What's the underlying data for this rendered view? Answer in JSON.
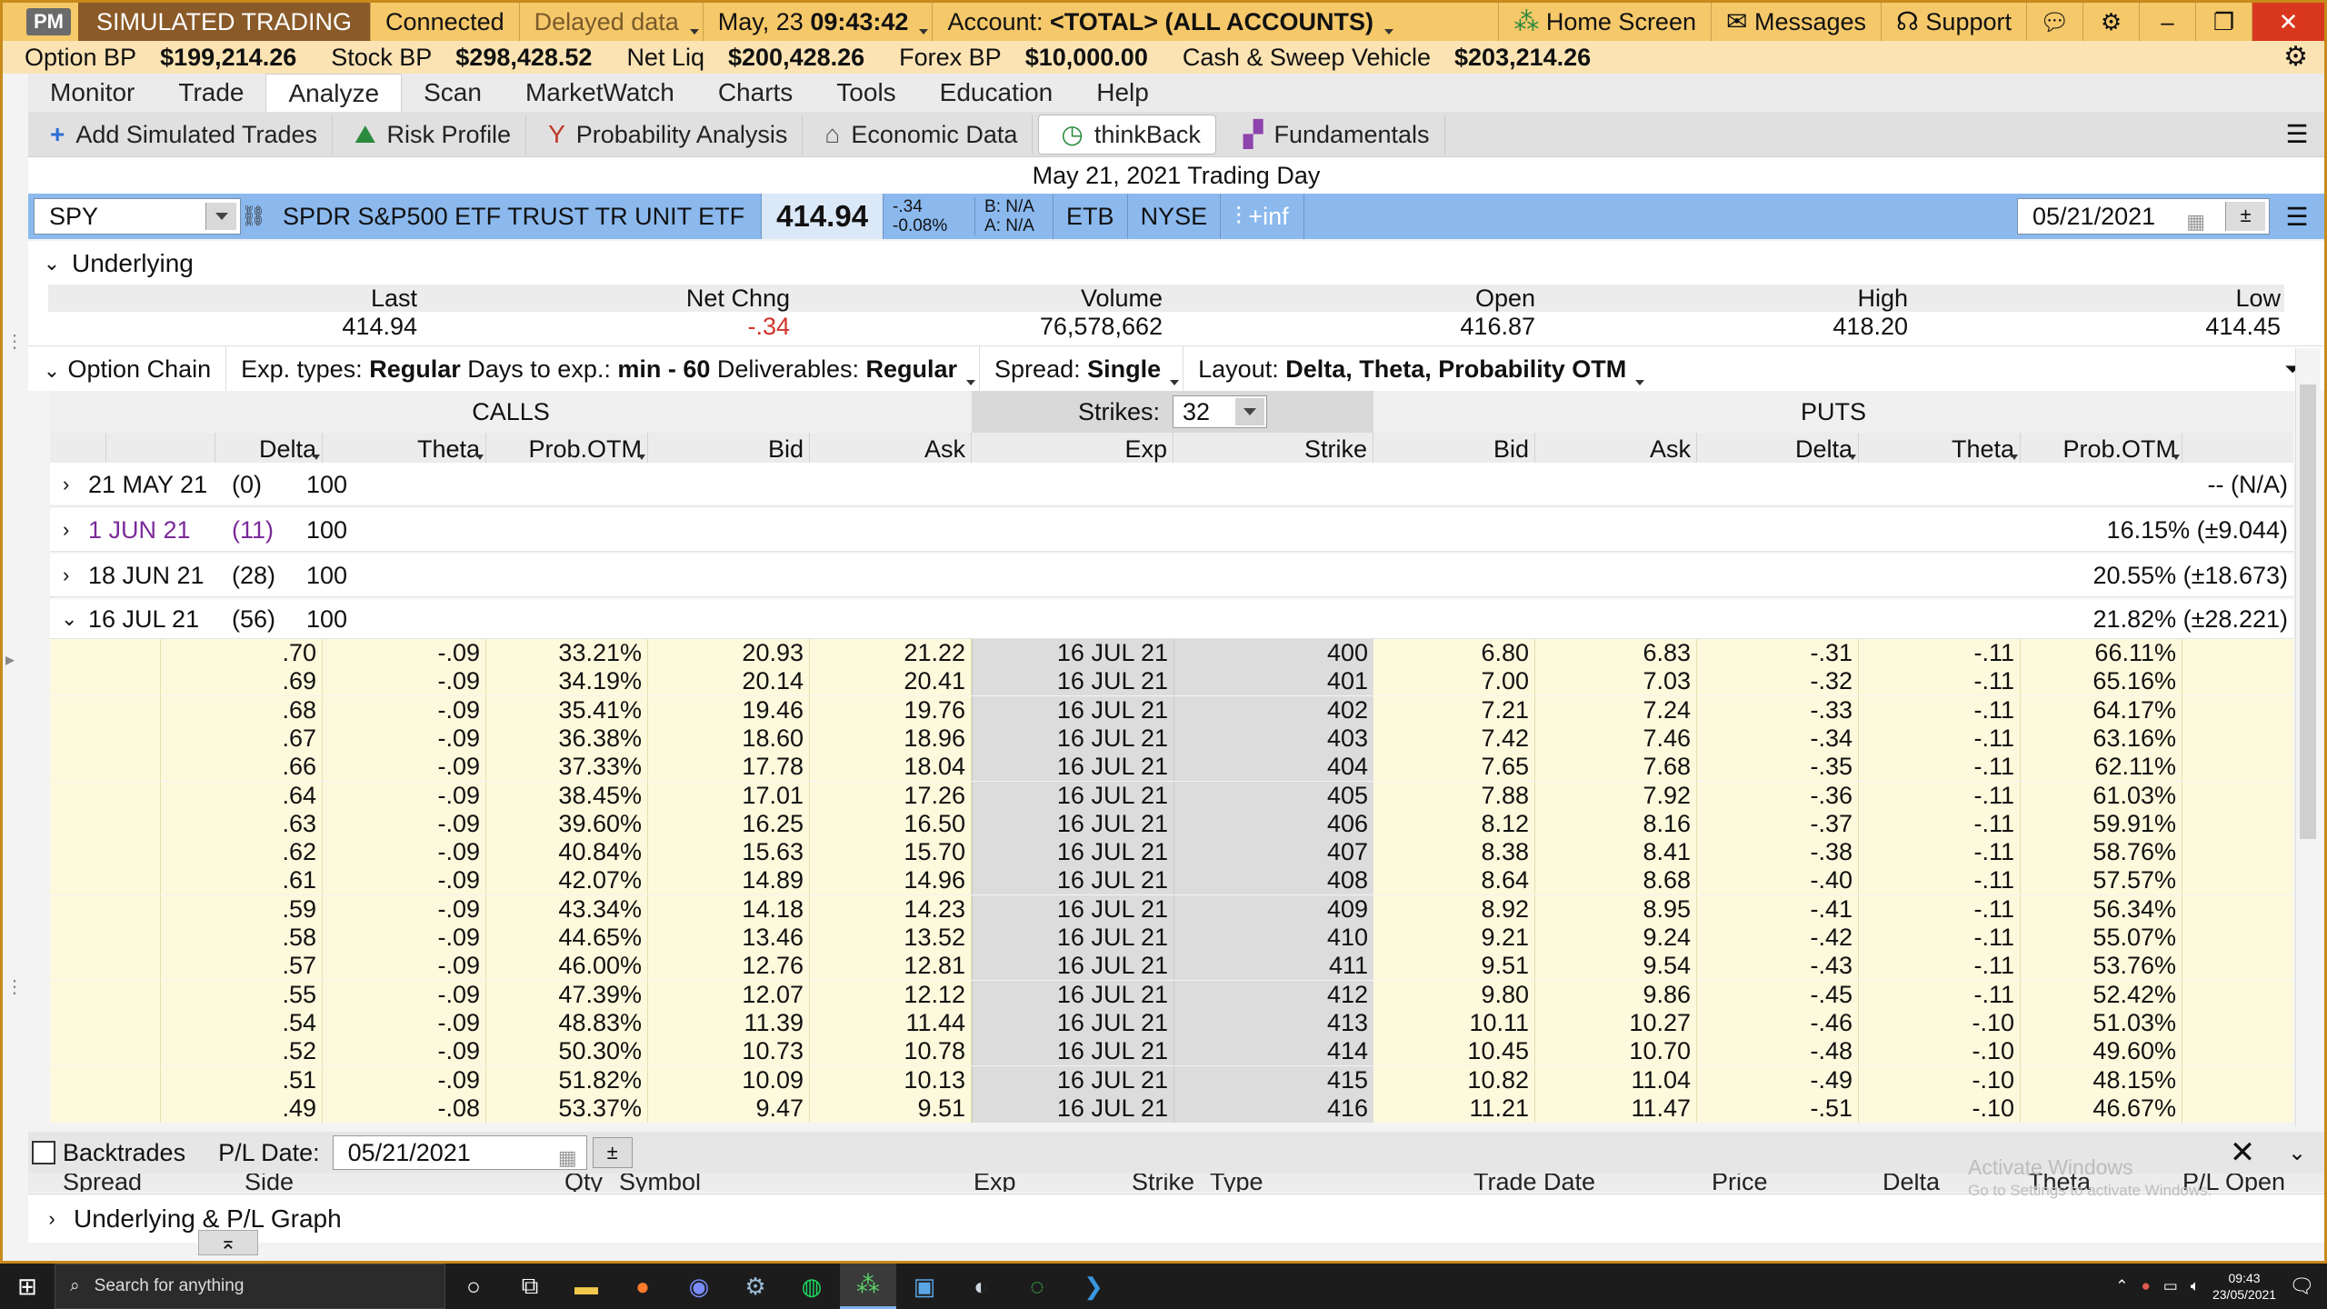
{
  "titlebar": {
    "pm": "PM",
    "mode": "SIMULATED TRADING",
    "status": "Connected",
    "data_mode": "Delayed data",
    "date": "May, 23",
    "time": "09:43:42",
    "account_label": "Account:",
    "account_value": "<TOTAL> (ALL ACCOUNTS)",
    "home": "Home Screen",
    "messages": "Messages",
    "support": "Support"
  },
  "bp": {
    "option_label": "Option BP",
    "option_value": "$199,214.26",
    "stock_label": "Stock BP",
    "stock_value": "$298,428.52",
    "netliq_label": "Net Liq",
    "netliq_value": "$200,428.26",
    "forex_label": "Forex BP",
    "forex_value": "$10,000.00",
    "cash_label": "Cash & Sweep Vehicle",
    "cash_value": "$203,214.26"
  },
  "menu": [
    "Monitor",
    "Trade",
    "Analyze",
    "Scan",
    "MarketWatch",
    "Charts",
    "Tools",
    "Education",
    "Help"
  ],
  "tools": {
    "add": "Add Simulated Trades",
    "risk": "Risk Profile",
    "prob": "Probability Analysis",
    "econ": "Economic Data",
    "thinkback": "thinkBack",
    "fund": "Fundamentals"
  },
  "trading_day": "May 21, 2021 Trading Day",
  "quote": {
    "symbol": "SPY",
    "description": "SPDR S&P500 ETF TRUST TR UNIT ETF",
    "last": "414.94",
    "chg": "-.34",
    "chg_pct": "-0.08%",
    "bid": "B: N/A",
    "ask": "A: N/A",
    "etb": "ETB",
    "exchange": "NYSE",
    "inf": "+inf",
    "date": "05/21/2021"
  },
  "underlying": {
    "title": "Underlying",
    "headers": [
      "Last",
      "Net Chng",
      "Volume",
      "Open",
      "High",
      "Low"
    ],
    "values": [
      "414.94",
      "-.34",
      "76,578,662",
      "416.87",
      "418.20",
      "414.45"
    ]
  },
  "option_chain": {
    "title": "Option Chain",
    "exp_label": "Exp. types:",
    "exp_value": "Regular",
    "days_label": "Days to exp.:",
    "days_value": "min - 60",
    "deliv_label": "Deliverables:",
    "deliv_value": "Regular",
    "spread_label": "Spread:",
    "spread_value": "Single",
    "layout_label": "Layout:",
    "layout_value": "Delta, Theta, Probability OTM",
    "calls": "CALLS",
    "puts": "PUTS",
    "strikes_label": "Strikes:",
    "strikes_value": "32",
    "columns": [
      "Delta",
      "Theta",
      "Prob.OTM",
      "Bid",
      "Ask",
      "Exp",
      "Strike",
      "Bid",
      "Ask",
      "Delta",
      "Theta",
      "Prob.OTM"
    ]
  },
  "expirations": [
    {
      "date": "21 MAY 21",
      "days": "(0)",
      "mult": "100",
      "iv": "-- (N/A)"
    },
    {
      "date": "1 JUN 21",
      "days": "(11)",
      "mult": "100",
      "iv": "16.15% (±9.044)"
    },
    {
      "date": "18 JUN 21",
      "days": "(28)",
      "mult": "100",
      "iv": "20.55% (±18.673)"
    },
    {
      "date": "16 JUL 21",
      "days": "(56)",
      "mult": "100",
      "iv": "21.82% (±28.221)"
    }
  ],
  "rows": [
    [
      ".70",
      "-.09",
      "33.21%",
      "20.93",
      "21.22",
      "16 JUL 21",
      "400",
      "6.80",
      "6.83",
      "-.31",
      "-.11",
      "66.11%"
    ],
    [
      ".69",
      "-.09",
      "34.19%",
      "20.14",
      "20.41",
      "16 JUL 21",
      "401",
      "7.00",
      "7.03",
      "-.32",
      "-.11",
      "65.16%"
    ],
    [
      ".68",
      "-.09",
      "35.41%",
      "19.46",
      "19.76",
      "16 JUL 21",
      "402",
      "7.21",
      "7.24",
      "-.33",
      "-.11",
      "64.17%"
    ],
    [
      ".67",
      "-.09",
      "36.38%",
      "18.60",
      "18.96",
      "16 JUL 21",
      "403",
      "7.42",
      "7.46",
      "-.34",
      "-.11",
      "63.16%"
    ],
    [
      ".66",
      "-.09",
      "37.33%",
      "17.78",
      "18.04",
      "16 JUL 21",
      "404",
      "7.65",
      "7.68",
      "-.35",
      "-.11",
      "62.11%"
    ],
    [
      ".64",
      "-.09",
      "38.45%",
      "17.01",
      "17.26",
      "16 JUL 21",
      "405",
      "7.88",
      "7.92",
      "-.36",
      "-.11",
      "61.03%"
    ],
    [
      ".63",
      "-.09",
      "39.60%",
      "16.25",
      "16.50",
      "16 JUL 21",
      "406",
      "8.12",
      "8.16",
      "-.37",
      "-.11",
      "59.91%"
    ],
    [
      ".62",
      "-.09",
      "40.84%",
      "15.63",
      "15.70",
      "16 JUL 21",
      "407",
      "8.38",
      "8.41",
      "-.38",
      "-.11",
      "58.76%"
    ],
    [
      ".61",
      "-.09",
      "42.07%",
      "14.89",
      "14.96",
      "16 JUL 21",
      "408",
      "8.64",
      "8.68",
      "-.40",
      "-.11",
      "57.57%"
    ],
    [
      ".59",
      "-.09",
      "43.34%",
      "14.18",
      "14.23",
      "16 JUL 21",
      "409",
      "8.92",
      "8.95",
      "-.41",
      "-.11",
      "56.34%"
    ],
    [
      ".58",
      "-.09",
      "44.65%",
      "13.46",
      "13.52",
      "16 JUL 21",
      "410",
      "9.21",
      "9.24",
      "-.42",
      "-.11",
      "55.07%"
    ],
    [
      ".57",
      "-.09",
      "46.00%",
      "12.76",
      "12.81",
      "16 JUL 21",
      "411",
      "9.51",
      "9.54",
      "-.43",
      "-.11",
      "53.76%"
    ],
    [
      ".55",
      "-.09",
      "47.39%",
      "12.07",
      "12.12",
      "16 JUL 21",
      "412",
      "9.80",
      "9.86",
      "-.45",
      "-.11",
      "52.42%"
    ],
    [
      ".54",
      "-.09",
      "48.83%",
      "11.39",
      "11.44",
      "16 JUL 21",
      "413",
      "10.11",
      "10.27",
      "-.46",
      "-.10",
      "51.03%"
    ],
    [
      ".52",
      "-.09",
      "50.30%",
      "10.73",
      "10.78",
      "16 JUL 21",
      "414",
      "10.45",
      "10.70",
      "-.48",
      "-.10",
      "49.60%"
    ],
    [
      ".51",
      "-.09",
      "51.82%",
      "10.09",
      "10.13",
      "16 JUL 21",
      "415",
      "10.82",
      "11.04",
      "-.49",
      "-.10",
      "48.15%"
    ],
    [
      ".49",
      "-.08",
      "53.37%",
      "9.47",
      "9.51",
      "16 JUL 21",
      "416",
      "11.21",
      "11.47",
      "-.51",
      "-.10",
      "46.67%"
    ]
  ],
  "backtrades": {
    "title": "Backtrades",
    "pl_label": "P/L Date:",
    "pl_date": "05/21/2021",
    "columns": [
      "Spread",
      "Side",
      "Qty",
      "Symbol",
      "Exp",
      "Strike",
      "Type",
      "Trade Date",
      "Price",
      "Delta",
      "Theta",
      "P/L Open"
    ]
  },
  "graph_title": "Underlying & P/L Graph",
  "watermark": {
    "line1": "Activate Windows",
    "line2": "Go to Settings to activate Windows."
  },
  "taskbar": {
    "search": "Search for anything",
    "time": "09:43",
    "date": "23/05/2021"
  },
  "colors": {
    "title_bar": "#f5c86a",
    "quote_bar": "#8bb9ee",
    "negative": "#d0342c",
    "cell_bg": "#fdf9dc",
    "purple": "#7a2a9a"
  }
}
